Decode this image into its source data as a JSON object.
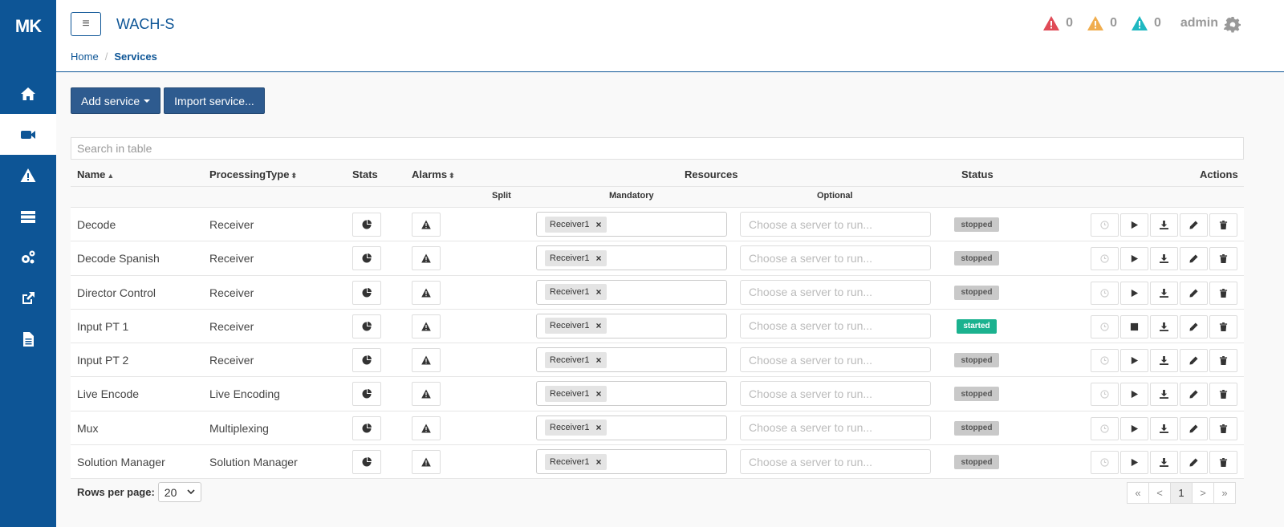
{
  "app": {
    "logo": "MK",
    "title": "WACH-S"
  },
  "breadcrumb": {
    "home": "Home",
    "current": "Services"
  },
  "header": {
    "alerts": [
      {
        "color": "#e04b57",
        "count": "0"
      },
      {
        "color": "#f0ad4e",
        "count": "0"
      },
      {
        "color": "#1fb8c1",
        "count": "0"
      }
    ],
    "user": "admin"
  },
  "sidebar": {
    "items": [
      {
        "icon": "home-icon",
        "active": false
      },
      {
        "icon": "video-camera-icon",
        "active": true
      },
      {
        "icon": "warning-icon",
        "active": false
      },
      {
        "icon": "servers-icon",
        "active": false
      },
      {
        "icon": "gears-icon",
        "active": false
      },
      {
        "icon": "external-link-icon",
        "active": false
      },
      {
        "icon": "document-icon",
        "active": false
      }
    ]
  },
  "toolbar": {
    "add_service": "Add service",
    "import_service": "Import service..."
  },
  "search": {
    "placeholder": "Search in table"
  },
  "table": {
    "headers": {
      "name": "Name",
      "processing_type": "ProcessingType",
      "stats": "Stats",
      "alarms": "Alarms",
      "resources": "Resources",
      "status": "Status",
      "actions": "Actions"
    },
    "subheaders": {
      "split": "Split",
      "mandatory": "Mandatory",
      "optional": "Optional"
    },
    "rows": [
      {
        "name": "Decode",
        "type": "Receiver",
        "resource": "Receiver1",
        "optional_placeholder": "Choose a server to run...",
        "status": "stopped"
      },
      {
        "name": "Decode Spanish",
        "type": "Receiver",
        "resource": "Receiver1",
        "optional_placeholder": "Choose a server to run...",
        "status": "stopped"
      },
      {
        "name": "Director Control",
        "type": "Receiver",
        "resource": "Receiver1",
        "optional_placeholder": "Choose a server to run...",
        "status": "stopped"
      },
      {
        "name": "Input PT 1",
        "type": "Receiver",
        "resource": "Receiver1",
        "optional_placeholder": "Choose a server to run...",
        "status": "started"
      },
      {
        "name": "Input PT 2",
        "type": "Receiver",
        "resource": "Receiver1",
        "optional_placeholder": "Choose a server to run...",
        "status": "stopped"
      },
      {
        "name": "Live Encode",
        "type": "Live Encoding",
        "resource": "Receiver1",
        "optional_placeholder": "Choose a server to run...",
        "status": "stopped"
      },
      {
        "name": "Mux",
        "type": "Multiplexing",
        "resource": "Receiver1",
        "optional_placeholder": "Choose a server to run...",
        "status": "stopped"
      },
      {
        "name": "Solution Manager",
        "type": "Solution Manager",
        "resource": "Receiver1",
        "optional_placeholder": "Choose a server to run...",
        "status": "stopped"
      }
    ]
  },
  "footer": {
    "rows_per_page_label": "Rows per page:",
    "rows_per_page_value": "20"
  },
  "pagination": {
    "first": "«",
    "prev": "<",
    "current": "1",
    "next": ">",
    "last": "»"
  }
}
